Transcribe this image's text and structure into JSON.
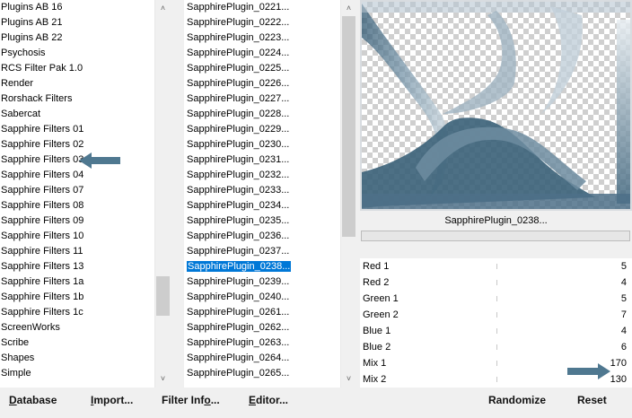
{
  "categories": {
    "items": [
      "Plugins AB 16",
      "Plugins AB 21",
      "Plugins AB 22",
      "Psychosis",
      "RCS Filter Pak 1.0",
      "Render",
      "Rorshack Filters",
      "Sabercat",
      "Sapphire Filters 01",
      "Sapphire Filters 02",
      "Sapphire Filters 03",
      "Sapphire Filters 04",
      "Sapphire Filters 07",
      "Sapphire Filters 08",
      "Sapphire Filters 09",
      "Sapphire Filters 10",
      "Sapphire Filters 11",
      "Sapphire Filters 13",
      "Sapphire Filters 1a",
      "Sapphire Filters 1b",
      "Sapphire Filters 1c",
      "ScreenWorks",
      "Scribe",
      "Shapes",
      "Simple"
    ]
  },
  "filters": {
    "items": [
      "SapphirePlugin_0221...",
      "SapphirePlugin_0222...",
      "SapphirePlugin_0223...",
      "SapphirePlugin_0224...",
      "SapphirePlugin_0225...",
      "SapphirePlugin_0226...",
      "SapphirePlugin_0227...",
      "SapphirePlugin_0228...",
      "SapphirePlugin_0229...",
      "SapphirePlugin_0230...",
      "SapphirePlugin_0231...",
      "SapphirePlugin_0232...",
      "SapphirePlugin_0233...",
      "SapphirePlugin_0234...",
      "SapphirePlugin_0235...",
      "SapphirePlugin_0236...",
      "SapphirePlugin_0237...",
      "SapphirePlugin_0238...",
      "SapphirePlugin_0239...",
      "SapphirePlugin_0240...",
      "SapphirePlugin_0261...",
      "SapphirePlugin_0262...",
      "SapphirePlugin_0263...",
      "SapphirePlugin_0264...",
      "SapphirePlugin_0265..."
    ],
    "selected_index": 17
  },
  "preview": {
    "filter_name": "SapphirePlugin_0238..."
  },
  "params": [
    {
      "label": "Red 1",
      "value": "5"
    },
    {
      "label": "Red 2",
      "value": "4"
    },
    {
      "label": "Green 1",
      "value": "5"
    },
    {
      "label": "Green 2",
      "value": "7"
    },
    {
      "label": "Blue 1",
      "value": "4"
    },
    {
      "label": "Blue 2",
      "value": "6"
    },
    {
      "label": "Mix 1",
      "value": "170"
    },
    {
      "label": "Mix 2",
      "value": "130"
    }
  ],
  "buttons": {
    "database": {
      "first": "D",
      "rest": "atabase"
    },
    "import": {
      "first": "I",
      "rest": "mport..."
    },
    "filter_info": {
      "first": "Filter Inf",
      "u": "o",
      "rest": "..."
    },
    "editor": {
      "first": "E",
      "rest": "ditor..."
    },
    "randomize": "Randomize",
    "reset": "Reset"
  },
  "icons": {
    "scroll_up": "chevron-up-icon",
    "scroll_down": "chevron-down-icon",
    "pointer": "arrow-left-icon"
  },
  "colors": {
    "selection": "#0078d7",
    "arrow": "#4f7890"
  }
}
